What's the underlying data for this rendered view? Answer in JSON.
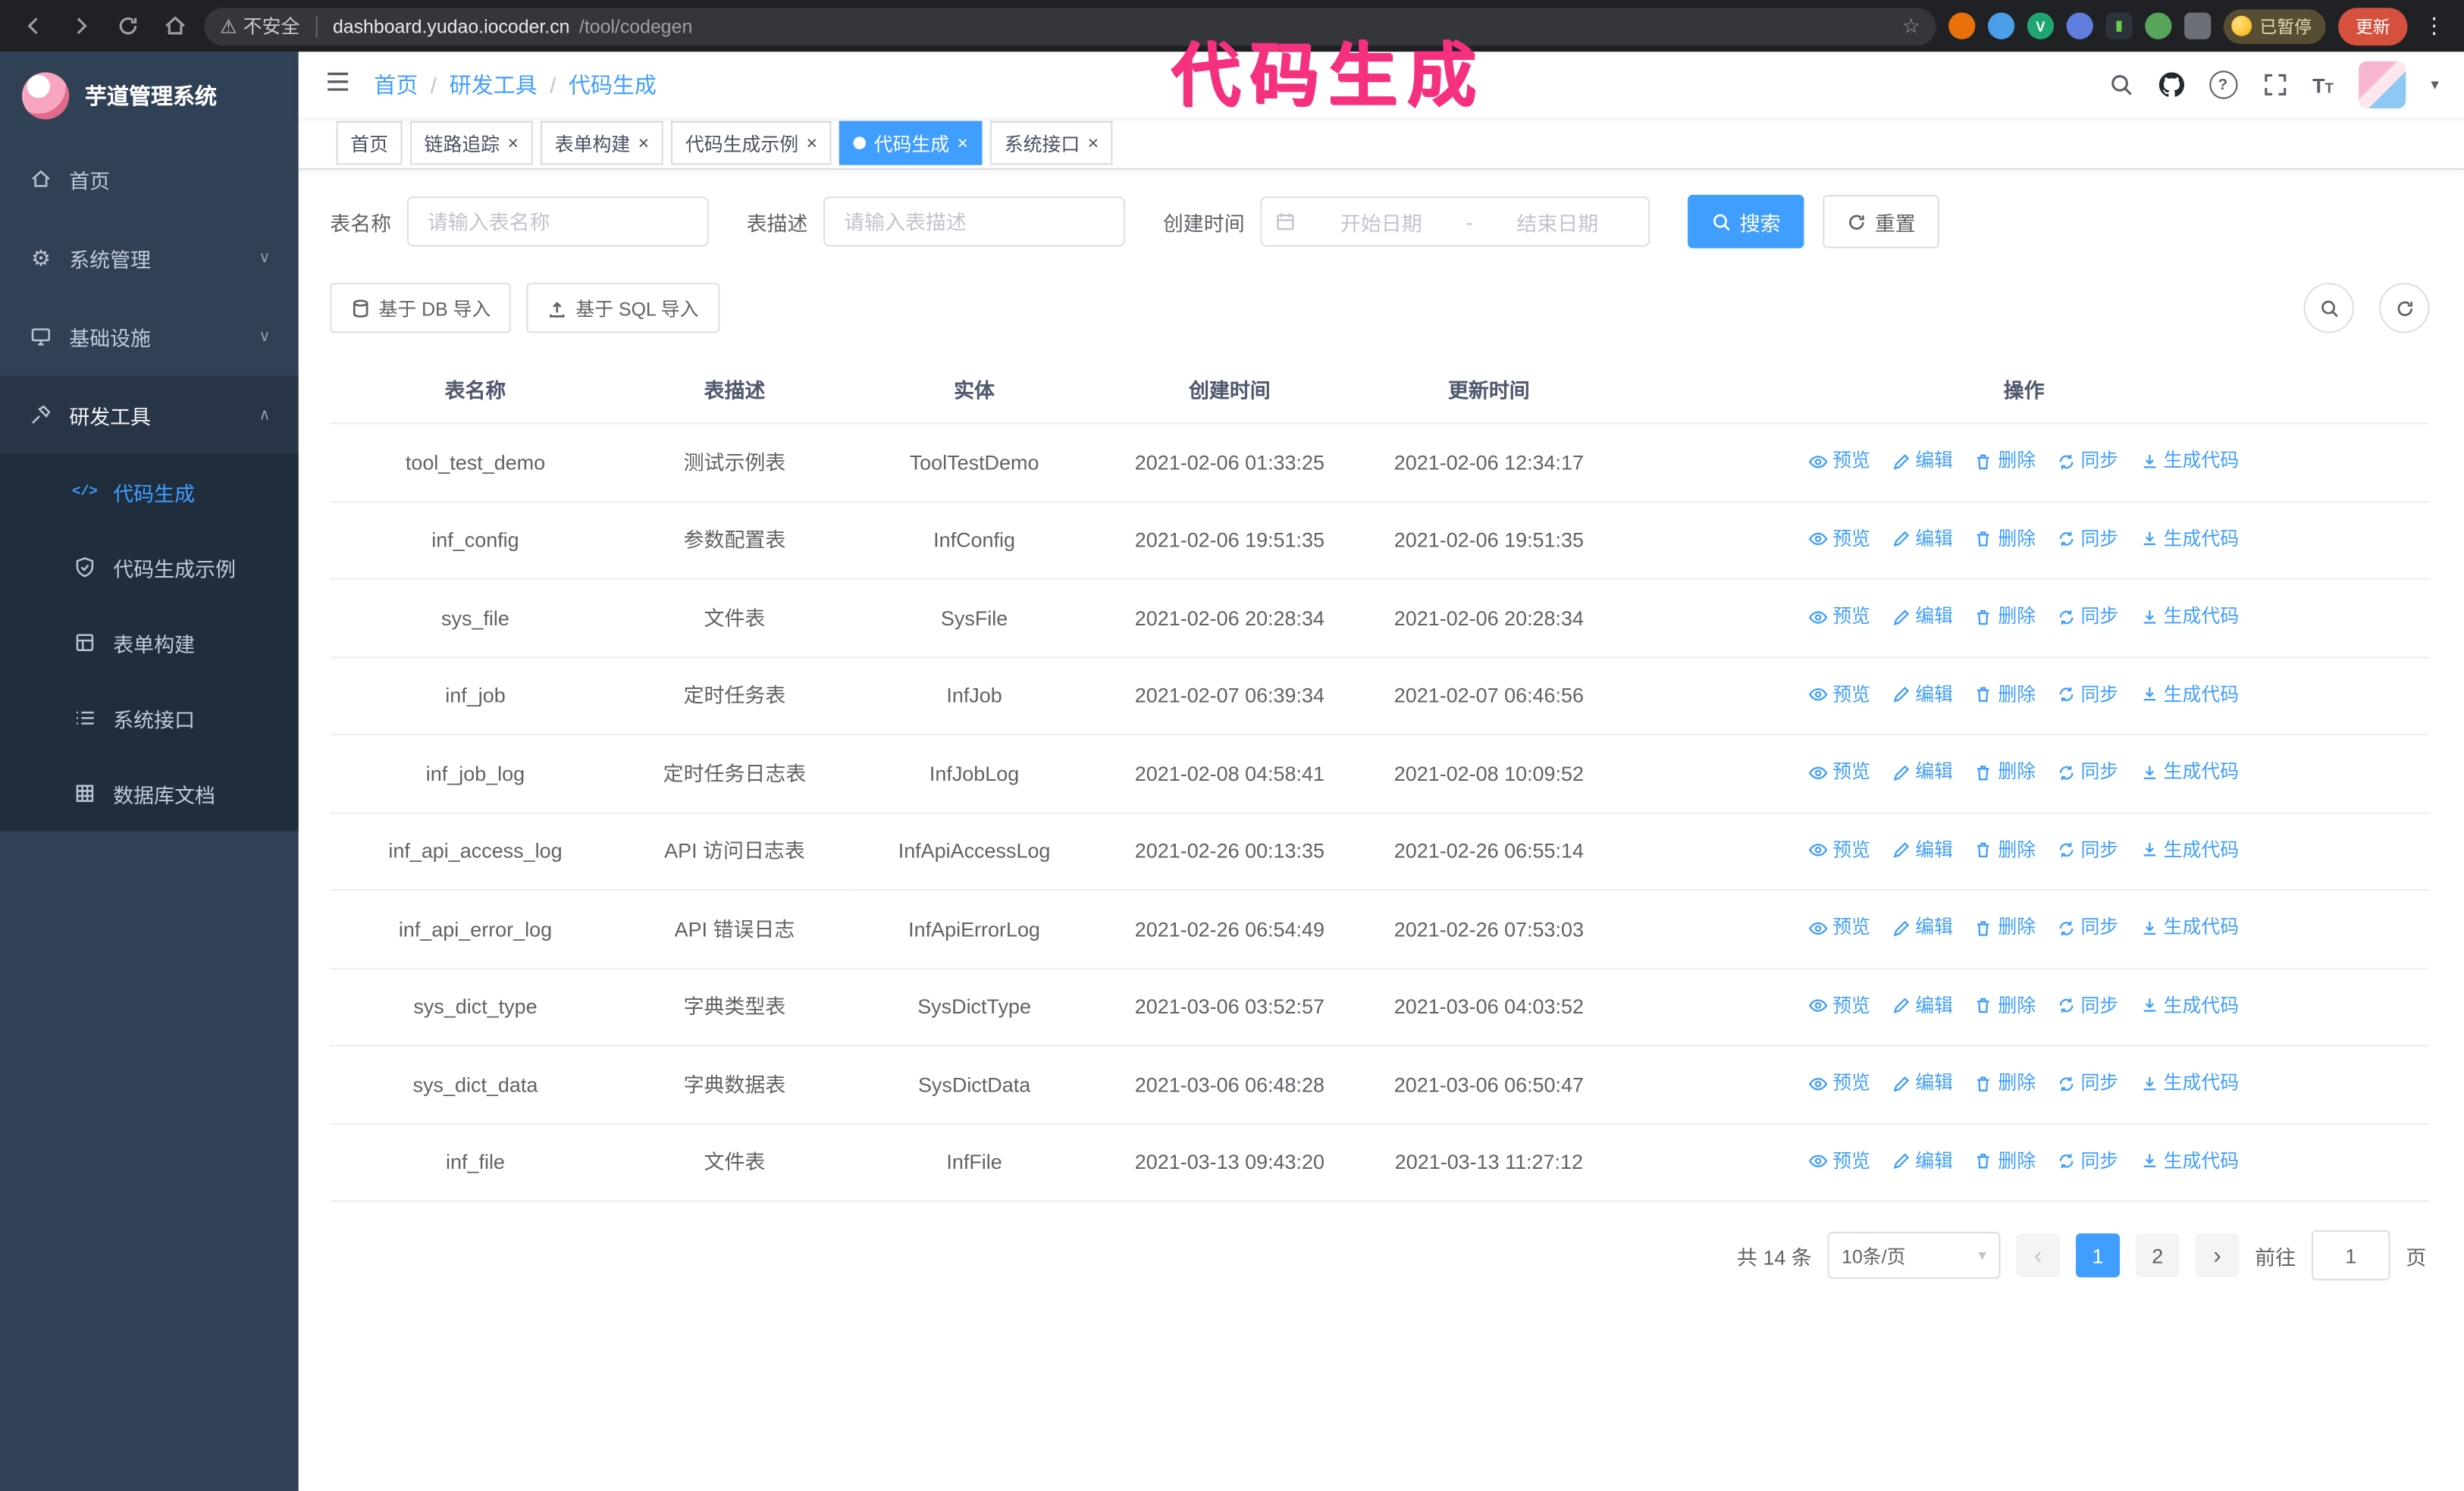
{
  "icons": {
    "warning": "⚠",
    "star": "☆",
    "kebab": "⋮",
    "close": "×",
    "chevron_down": "∨",
    "chevron_up": "∧",
    "caret_down": "▾",
    "separator": "/",
    "prev": "‹",
    "next": "›",
    "code": "</>",
    "gear": "⚙"
  },
  "browser": {
    "security_label": "不安全",
    "url_host": "dashboard.yudao.iocoder.cn",
    "url_path": "/tool/codegen",
    "paused_badge": "已暂停",
    "update_button": "更新"
  },
  "annotation": {
    "text": "代码生成",
    "color": "#f5317f"
  },
  "sidebar": {
    "logo_title": "芋道管理系统",
    "items": [
      {
        "label": "首页"
      },
      {
        "label": "系统管理"
      },
      {
        "label": "基础设施"
      },
      {
        "label": "研发工具"
      }
    ],
    "submenu": [
      {
        "label": "代码生成"
      },
      {
        "label": "代码生成示例"
      },
      {
        "label": "表单构建"
      },
      {
        "label": "系统接口"
      },
      {
        "label": "数据库文档"
      }
    ]
  },
  "header": {
    "breadcrumb": [
      "首页",
      "研发工具",
      "代码生成"
    ]
  },
  "tabs": [
    {
      "label": "首页"
    },
    {
      "label": "链路追踪"
    },
    {
      "label": "表单构建"
    },
    {
      "label": "代码生成示例"
    },
    {
      "label": "代码生成"
    },
    {
      "label": "系统接口"
    }
  ],
  "filters": {
    "table_name_label": "表名称",
    "table_name_placeholder": "请输入表名称",
    "table_desc_label": "表描述",
    "table_desc_placeholder": "请输入表描述",
    "create_time_label": "创建时间",
    "date_start_placeholder": "开始日期",
    "date_separator": "-",
    "date_end_placeholder": "结束日期",
    "search_button": "搜索",
    "reset_button": "重置"
  },
  "toolbar": {
    "import_db": "基于 DB 导入",
    "import_sql": "基于 SQL 导入"
  },
  "table": {
    "columns": [
      "表名称",
      "表描述",
      "实体",
      "创建时间",
      "更新时间",
      "操作"
    ],
    "actions": [
      "预览",
      "编辑",
      "删除",
      "同步",
      "生成代码"
    ],
    "rows": [
      {
        "name": "tool_test_demo",
        "desc": "测试示例表",
        "entity": "ToolTestDemo",
        "created": "2021-02-06 01:33:25",
        "updated": "2021-02-06 12:34:17"
      },
      {
        "name": "inf_config",
        "desc": "参数配置表",
        "entity": "InfConfig",
        "created": "2021-02-06 19:51:35",
        "updated": "2021-02-06 19:51:35"
      },
      {
        "name": "sys_file",
        "desc": "文件表",
        "entity": "SysFile",
        "created": "2021-02-06 20:28:34",
        "updated": "2021-02-06 20:28:34"
      },
      {
        "name": "inf_job",
        "desc": "定时任务表",
        "entity": "InfJob",
        "created": "2021-02-07 06:39:34",
        "updated": "2021-02-07 06:46:56"
      },
      {
        "name": "inf_job_log",
        "desc": "定时任务日志表",
        "entity": "InfJobLog",
        "created": "2021-02-08 04:58:41",
        "updated": "2021-02-08 10:09:52"
      },
      {
        "name": "inf_api_access_log",
        "desc": "API 访问日志表",
        "entity": "InfApiAccessLog",
        "created": "2021-02-26 00:13:35",
        "updated": "2021-02-26 06:55:14"
      },
      {
        "name": "inf_api_error_log",
        "desc": "API 错误日志",
        "entity": "InfApiErrorLog",
        "created": "2021-02-26 06:54:49",
        "updated": "2021-02-26 07:53:03"
      },
      {
        "name": "sys_dict_type",
        "desc": "字典类型表",
        "entity": "SysDictType",
        "created": "2021-03-06 03:52:57",
        "updated": "2021-03-06 04:03:52"
      },
      {
        "name": "sys_dict_data",
        "desc": "字典数据表",
        "entity": "SysDictData",
        "created": "2021-03-06 06:48:28",
        "updated": "2021-03-06 06:50:47"
      },
      {
        "name": "inf_file",
        "desc": "文件表",
        "entity": "InfFile",
        "created": "2021-03-13 09:43:20",
        "updated": "2021-03-13 11:27:12"
      }
    ]
  },
  "pagination": {
    "total_text": "共 14 条",
    "page_size": "10条/页",
    "pages": [
      "1",
      "2"
    ],
    "goto_label": "前往",
    "goto_value": "1",
    "goto_suffix": "页"
  }
}
